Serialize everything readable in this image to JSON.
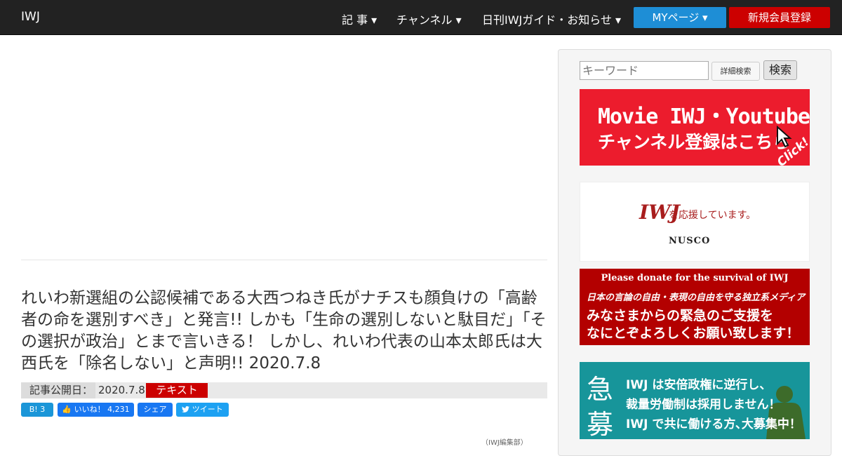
{
  "navbar": {
    "brand": "IWJ",
    "items": [
      {
        "label": "記 事 ▾"
      },
      {
        "label": "チャンネル ▾"
      },
      {
        "label": "日刊IWJガイド・お知らせ ▾"
      }
    ],
    "my_page": "MYページ ▾",
    "register": "新規会員登録"
  },
  "article": {
    "title": "れいわ新選組の公認候補である大西つねき氏がナチスも顔負けの「高齢者の命を選別すべき」と発言!! しかも「生命の選別しないと駄目だ」「その選択が政治」とまで言いきる！ しかし、れいわ代表の山本太郎氏は大西氏を「除名しない」と声明!! 2020.7.8",
    "published_label": "記事公開日：",
    "published_date": "2020.7.8",
    "tag": "テキスト",
    "byline": "（IWJ編集部）"
  },
  "share": {
    "hatena": "B! 3",
    "like": "👍 いいね！ 4,231",
    "fb_share": "シェア",
    "tweet": "ツイート"
  },
  "sidebar": {
    "search_placeholder": "キーワード",
    "detail_search": "詳細検索",
    "search_button": "検索",
    "banner1": {
      "line1": "Movie IWJ・Youtube",
      "line2": "チャンネル登録はこちら",
      "click": "Click!"
    },
    "banner2": {
      "logo": "IWJ",
      "text": "を応援しています。",
      "sponsor": "NUSCO"
    },
    "banner3": {
      "line1": "Please donate for the survival of IWJ",
      "line2": "日本の言論の自由・表現の自由を守る独立系メディア",
      "line3": "みなさまからの緊急のご支援を",
      "line4": "なにとぞよろしくお願い致します！"
    },
    "banner4": {
      "big1": "急",
      "big2": "募",
      "line1": "IWJ は安倍政権に逆行し、",
      "line2": "裁量労働制は採用しません！",
      "line3": "IWJ で共に働ける方､大募集中！"
    }
  },
  "colors": {
    "navbar_bg": "#222222",
    "my_page_btn": "#1e8ed6",
    "register_btn": "#cc0000",
    "tag_red": "#cc0000",
    "banner_red": "#ec1c2d",
    "banner_dark_red": "#b30000",
    "banner_teal": "#17959a"
  },
  "icons": [
    "caret-down-icon",
    "cursor-arrow-icon",
    "thumbs-up-icon",
    "twitter-bird-icon",
    "person-silhouette-icon"
  ]
}
